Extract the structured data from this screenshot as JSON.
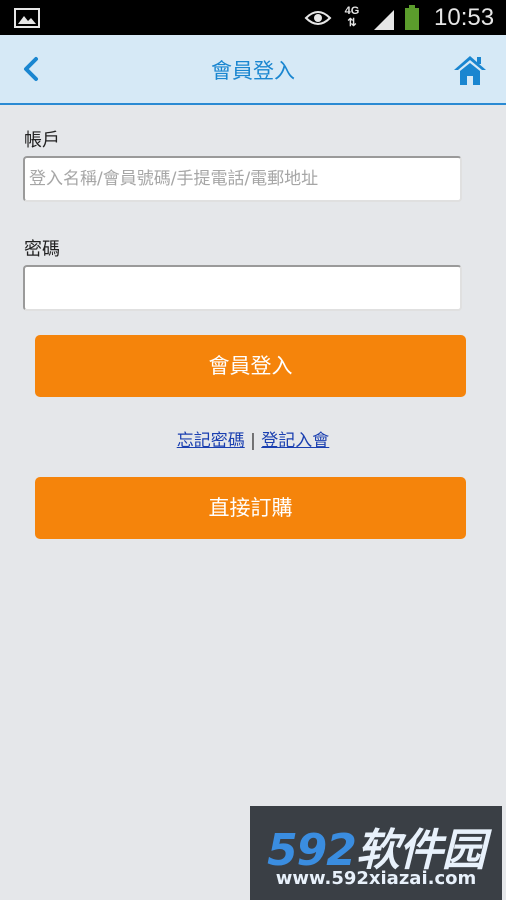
{
  "status_bar": {
    "network": "4G",
    "time": "10:53",
    "icons": [
      "image-icon",
      "eye-icon",
      "network-arrows-icon",
      "signal-icon",
      "battery-icon"
    ]
  },
  "header": {
    "title": "會員登入",
    "back_icon": "chevron-left-icon",
    "home_icon": "home-icon",
    "accent_color": "#1a86d0"
  },
  "form": {
    "account_label": "帳戶",
    "account_placeholder": "登入名稱/會員號碼/手提電話/電郵地址",
    "account_value": "",
    "password_label": "密碼",
    "password_value": ""
  },
  "actions": {
    "login_button": "會員登入",
    "forgot_password": "忘記密碼",
    "separator": "|",
    "register": "登記入會",
    "direct_order_button": "直接訂購",
    "button_color": "#f5840b"
  },
  "watermark": {
    "logo_num": "592",
    "logo_text": "软件园",
    "url": "www.592xiazai.com"
  }
}
